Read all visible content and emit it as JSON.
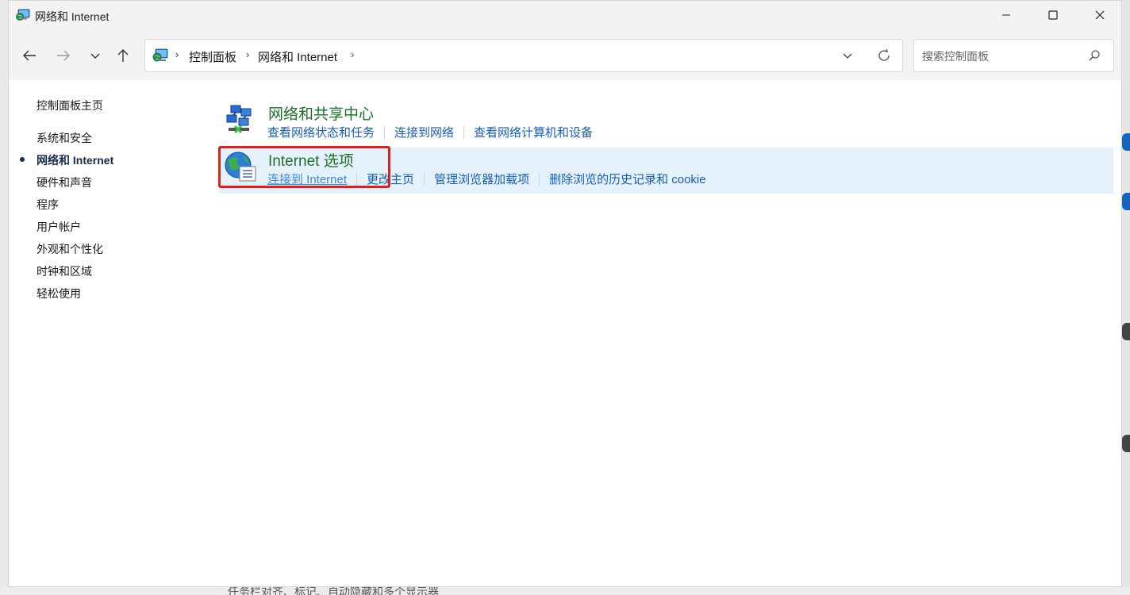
{
  "window": {
    "title": "网络和 Internet",
    "title_icon": "network-globe-icon",
    "controls": {
      "minimize": "minimize-icon",
      "maximize": "maximize-icon",
      "close": "close-icon"
    }
  },
  "nav": {
    "back": "arrow-left-icon",
    "forward": "arrow-right-icon",
    "recent": "chevron-down-icon",
    "up": "arrow-up-icon"
  },
  "address": {
    "breadcrumbs": [
      "控制面板",
      "网络和 Internet"
    ],
    "dropdown_icon": "chevron-down-icon",
    "refresh_icon": "refresh-icon"
  },
  "search": {
    "placeholder": "搜索控制面板",
    "value": ""
  },
  "sidebar": {
    "home": "控制面板主页",
    "items": [
      {
        "label": "系统和安全",
        "active": false
      },
      {
        "label": "网络和 Internet",
        "active": true
      },
      {
        "label": "硬件和声音",
        "active": false
      },
      {
        "label": "程序",
        "active": false
      },
      {
        "label": "用户帐户",
        "active": false
      },
      {
        "label": "外观和个性化",
        "active": false
      },
      {
        "label": "时钟和区域",
        "active": false
      },
      {
        "label": "轻松使用",
        "active": false
      }
    ]
  },
  "categories": [
    {
      "title": "网络和共享中心",
      "icon": "network-sharing-center-icon",
      "links": [
        "查看网络状态和任务",
        "连接到网络",
        "查看网络计算机和设备"
      ]
    },
    {
      "title": "Internet 选项",
      "icon": "internet-options-icon",
      "links": [
        "连接到 Internet",
        "更改主页",
        "管理浏览器加载项",
        "删除浏览的历史记录和 cookie"
      ]
    }
  ],
  "background": {
    "taskbar_text": "任务栏对齐、标记、自动隐藏和多个显示器"
  },
  "colors": {
    "link": "#1a5fb4",
    "title_green": "#1e6e2a",
    "highlight": "#e5f1fb",
    "annotation_red": "#e0201b"
  }
}
